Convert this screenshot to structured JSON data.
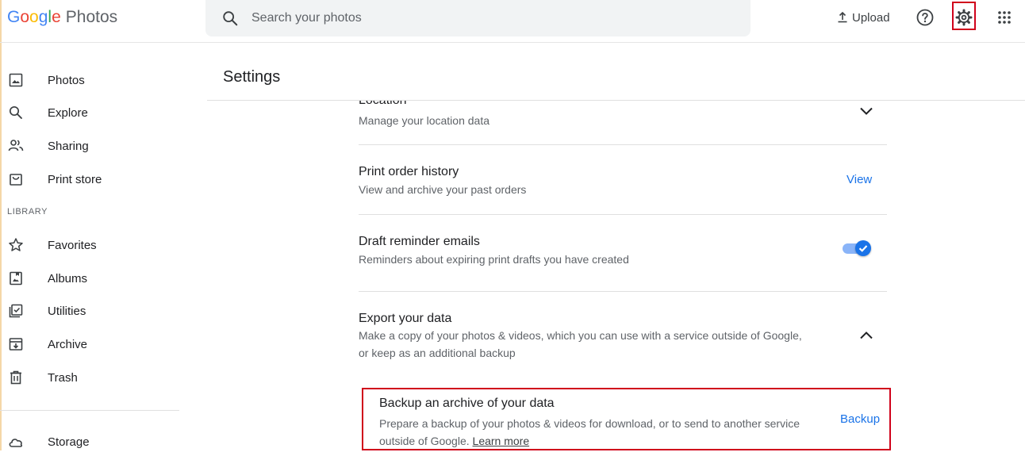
{
  "app": {
    "logo_letters": [
      "G",
      "o",
      "o",
      "g",
      "l",
      "e"
    ],
    "product_name": "Photos"
  },
  "search": {
    "placeholder": "Search your photos",
    "value": ""
  },
  "header": {
    "upload_label": "Upload"
  },
  "sidebar": {
    "main_items": [
      {
        "label": "Photos",
        "icon": "photo-icon"
      },
      {
        "label": "Explore",
        "icon": "search-icon"
      },
      {
        "label": "Sharing",
        "icon": "people-icon"
      },
      {
        "label": "Print store",
        "icon": "shopping-bag-icon"
      }
    ],
    "library_label": "LIBRARY",
    "library_items": [
      {
        "label": "Favorites",
        "icon": "star-icon"
      },
      {
        "label": "Albums",
        "icon": "album-icon"
      },
      {
        "label": "Utilities",
        "icon": "checkbox-icon"
      },
      {
        "label": "Archive",
        "icon": "archive-icon"
      },
      {
        "label": "Trash",
        "icon": "trash-icon"
      }
    ],
    "storage_label": "Storage"
  },
  "settings": {
    "title": "Settings",
    "location": {
      "title": "Location",
      "description": "Manage your location data"
    },
    "print_order": {
      "title": "Print order history",
      "description": "View and archive your past orders",
      "action": "View"
    },
    "draft_reminder": {
      "title": "Draft reminder emails",
      "description": "Reminders about expiring print drafts you have created",
      "enabled": true
    },
    "export": {
      "title": "Export your data",
      "description": "Make a copy of your photos & videos, which you can use with a service outside of Google, or keep as an additional backup",
      "expanded": true
    },
    "backup": {
      "title": "Backup an archive of your data",
      "description": "Prepare a backup of your photos & videos for download, or to send to another service outside of Google.",
      "learn_more": "Learn more",
      "action": "Backup"
    }
  },
  "colors": {
    "accent": "#1a73e8",
    "highlight_border": "#d0021b"
  }
}
